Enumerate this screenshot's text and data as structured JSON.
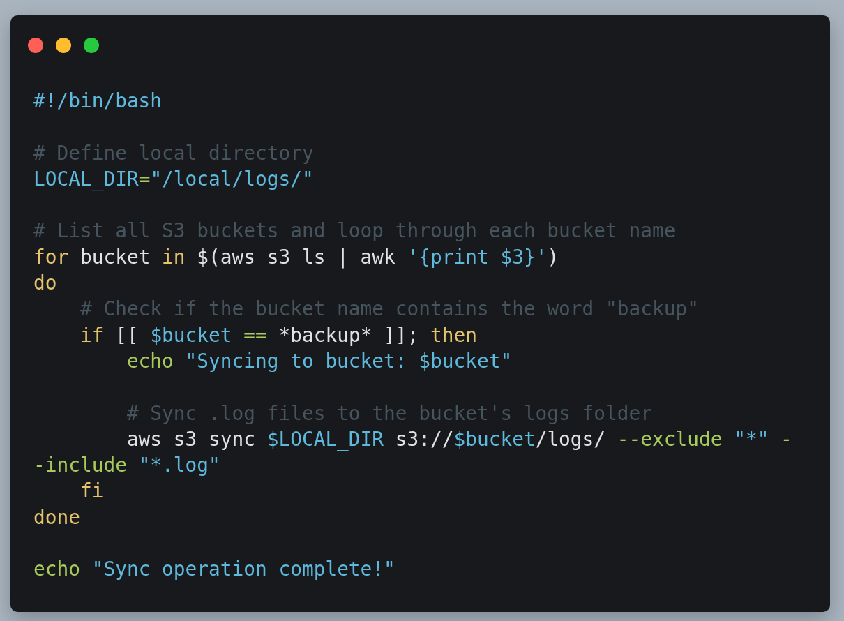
{
  "window": {
    "controls": [
      {
        "kind": "close"
      },
      {
        "kind": "minimize"
      },
      {
        "kind": "zoom"
      }
    ]
  },
  "code_lines": [
    {
      "kind": "code",
      "tokens": [
        {
          "kind": "string",
          "text": "#!/bin/bash"
        }
      ]
    },
    {
      "kind": "blank"
    },
    {
      "kind": "code",
      "tokens": [
        {
          "kind": "comment",
          "text": "# Define local directory"
        }
      ]
    },
    {
      "kind": "code",
      "tokens": [
        {
          "kind": "variable",
          "text": "LOCAL_DIR"
        },
        {
          "kind": "operator",
          "text": "="
        },
        {
          "kind": "string",
          "text": "\"/local/logs/\""
        }
      ]
    },
    {
      "kind": "blank"
    },
    {
      "kind": "code",
      "tokens": [
        {
          "kind": "comment",
          "text": "# List all S3 buckets and loop through each bucket name"
        }
      ]
    },
    {
      "kind": "code",
      "tokens": [
        {
          "kind": "keyword",
          "text": "for"
        },
        {
          "kind": "plain",
          "text": " bucket "
        },
        {
          "kind": "keyword",
          "text": "in"
        },
        {
          "kind": "plain",
          "text": " $(aws s3 ls | awk "
        },
        {
          "kind": "string",
          "text": "'{print $3}'"
        },
        {
          "kind": "plain",
          "text": ")"
        }
      ]
    },
    {
      "kind": "code",
      "tokens": [
        {
          "kind": "keyword",
          "text": "do"
        }
      ]
    },
    {
      "kind": "code",
      "tokens": [
        {
          "kind": "comment",
          "text": "    # Check if the bucket name contains the word \"backup\""
        }
      ]
    },
    {
      "kind": "code",
      "tokens": [
        {
          "kind": "keyword",
          "text": "    if"
        },
        {
          "kind": "plain",
          "text": " [[ "
        },
        {
          "kind": "variable",
          "text": "$bucket"
        },
        {
          "kind": "operator",
          "text": " =="
        },
        {
          "kind": "plain",
          "text": " *backup* ]]; "
        },
        {
          "kind": "keyword",
          "text": "then"
        }
      ]
    },
    {
      "kind": "code",
      "tokens": [
        {
          "kind": "operator",
          "text": "        echo"
        },
        {
          "kind": "string",
          "text": " \"Syncing to bucket: $bucket\""
        }
      ]
    },
    {
      "kind": "blank"
    },
    {
      "kind": "code",
      "tokens": [
        {
          "kind": "comment",
          "text": "        # Sync .log files to the bucket's logs folder"
        }
      ]
    },
    {
      "kind": "code",
      "tokens": [
        {
          "kind": "plain",
          "text": "        aws s3 sync "
        },
        {
          "kind": "variable",
          "text": "$LOCAL_DIR"
        },
        {
          "kind": "plain",
          "text": " s3://"
        },
        {
          "kind": "variable",
          "text": "$bucket"
        },
        {
          "kind": "plain",
          "text": "/logs/ "
        },
        {
          "kind": "operator",
          "text": "--exclude"
        },
        {
          "kind": "string",
          "text": " \"*\""
        },
        {
          "kind": "operator",
          "text": " -"
        }
      ]
    },
    {
      "kind": "code",
      "tokens": [
        {
          "kind": "operator",
          "text": "-include"
        },
        {
          "kind": "string",
          "text": " \"*.log\""
        }
      ]
    },
    {
      "kind": "code",
      "tokens": [
        {
          "kind": "keyword",
          "text": "    fi"
        }
      ]
    },
    {
      "kind": "code",
      "tokens": [
        {
          "kind": "keyword",
          "text": "done"
        }
      ]
    },
    {
      "kind": "blank"
    },
    {
      "kind": "code",
      "tokens": [
        {
          "kind": "operator",
          "text": "echo"
        },
        {
          "kind": "string",
          "text": " \"Sync operation complete!\""
        }
      ]
    }
  ]
}
